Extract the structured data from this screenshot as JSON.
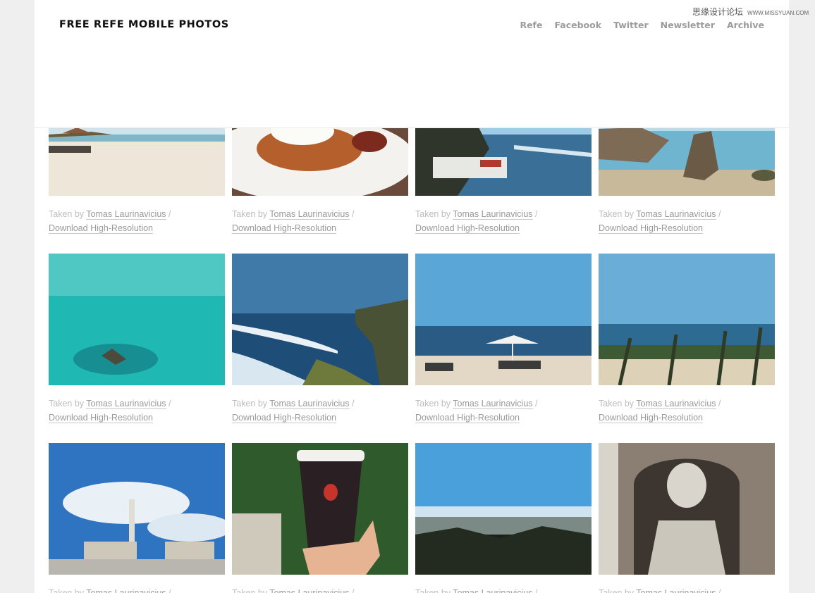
{
  "site": {
    "title": "FREE REFE MOBILE PHOTOS",
    "nav": [
      "Refe",
      "Facebook",
      "Twitter",
      "Newsletter",
      "Archive"
    ]
  },
  "watermark": {
    "cn": "思缘设计论坛",
    "url": "WWW.MISSYUAN.COM"
  },
  "caption": {
    "taken_by": "Taken by",
    "author": "Tomas Laurinavicius",
    "separator": "/",
    "download": "Download High-Resolution"
  },
  "photos": [
    {
      "name": "beach-sand",
      "subject": "sandy beach with huts"
    },
    {
      "name": "rice-plate",
      "subject": "plate of fried rice with egg"
    },
    {
      "name": "cliff-coast",
      "subject": "cliff coastline with sea"
    },
    {
      "name": "rocky-shore",
      "subject": "rocks on shallow shore"
    },
    {
      "name": "turquoise-sea",
      "subject": "turquoise sea from above"
    },
    {
      "name": "cliff-waves",
      "subject": "cliff with breaking waves"
    },
    {
      "name": "beach-umbrellas",
      "subject": "beach with umbrellas and loungers"
    },
    {
      "name": "palm-coast",
      "subject": "palm trees along coast"
    },
    {
      "name": "heroes-square",
      "subject": "monument column and colonnade"
    },
    {
      "name": "coffee-cup",
      "subject": "hand holding coffee cup on tree lined path"
    },
    {
      "name": "city-view",
      "subject": "city panorama with river"
    },
    {
      "name": "stone-statue",
      "subject": "stone statue bust"
    }
  ]
}
